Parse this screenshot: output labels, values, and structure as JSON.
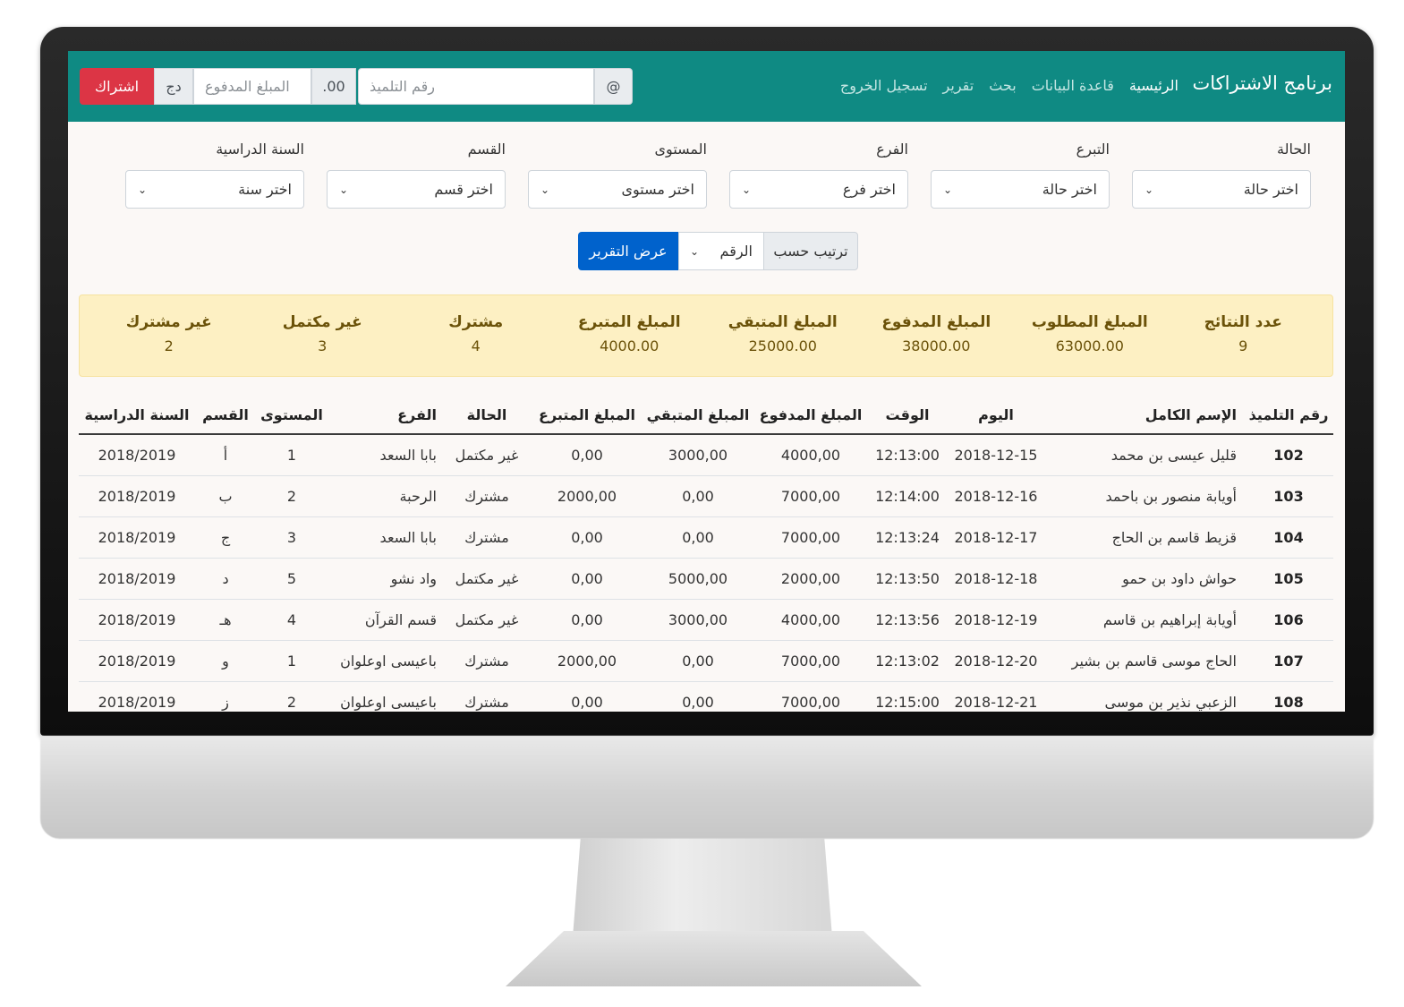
{
  "navbar": {
    "brand": "برنامج الاشتراكات",
    "links": [
      "الرئيسية",
      "قاعدة البيانات",
      "بحث",
      "تقرير",
      "تسجيل الخروج"
    ],
    "student_placeholder": "رقم التلميذ",
    "at_symbol": "@",
    "cents_addon": ".00",
    "amount_placeholder": "المبلغ المدفوع",
    "currency_addon": "دج",
    "subscribe_label": "اشتراك"
  },
  "filters": [
    {
      "label": "الحالة",
      "value": "اختر حالة"
    },
    {
      "label": "التبرع",
      "value": "اختر حالة"
    },
    {
      "label": "الفرع",
      "value": "اختر فرع"
    },
    {
      "label": "المستوى",
      "value": "اختر مستوى"
    },
    {
      "label": "القسم",
      "value": "اختر قسم"
    },
    {
      "label": "السنة الدراسية",
      "value": "اختر سنة"
    }
  ],
  "report": {
    "sort_label": "ترتيب حسب",
    "sort_value": "الرقم",
    "button_label": "عرض التقرير"
  },
  "summary": [
    {
      "title": "عدد النتائج",
      "value": "9"
    },
    {
      "title": "المبلغ المطلوب",
      "value": "63000.00"
    },
    {
      "title": "المبلغ المدفوع",
      "value": "38000.00"
    },
    {
      "title": "المبلغ المتبقي",
      "value": "25000.00"
    },
    {
      "title": "المبلغ المتبرع",
      "value": "4000.00"
    },
    {
      "title": "مشترك",
      "value": "4"
    },
    {
      "title": "غير مكتمل",
      "value": "3"
    },
    {
      "title": "غير مشترك",
      "value": "2"
    }
  ],
  "table": {
    "headers": [
      "رقم التلميذ",
      "الإسم الكامل",
      "اليوم",
      "الوقت",
      "المبلغ المدفوع",
      "المبلغ المتبقي",
      "المبلغ المتبرع",
      "الحالة",
      "الفرع",
      "المستوى",
      "القسم",
      "السنة الدراسية"
    ],
    "rows": [
      [
        "102",
        "قليل عيسى بن محمد",
        "2018-12-15",
        "12:13:00",
        "4000,00",
        "3000,00",
        "0,00",
        "غير مكتمل",
        "بابا السعد",
        "1",
        "أ",
        "2018/2019"
      ],
      [
        "103",
        "أويابة منصور بن باحمد",
        "2018-12-16",
        "12:14:00",
        "7000,00",
        "0,00",
        "2000,00",
        "مشترك",
        "الرحبة",
        "2",
        "ب",
        "2018/2019"
      ],
      [
        "104",
        "قزيط قاسم بن الحاج",
        "2018-12-17",
        "12:13:24",
        "7000,00",
        "0,00",
        "0,00",
        "مشترك",
        "بابا السعد",
        "3",
        "ج",
        "2018/2019"
      ],
      [
        "105",
        "حواش داود بن حمو",
        "2018-12-18",
        "12:13:50",
        "2000,00",
        "5000,00",
        "0,00",
        "غير مكتمل",
        "واد نشو",
        "5",
        "د",
        "2018/2019"
      ],
      [
        "106",
        "أويابة إبراهيم بن قاسم",
        "2018-12-19",
        "12:13:56",
        "4000,00",
        "3000,00",
        "0,00",
        "غير مكتمل",
        "قسم القرآن",
        "4",
        "هـ",
        "2018/2019"
      ],
      [
        "107",
        "الحاج موسى قاسم بن بشير",
        "2018-12-20",
        "12:13:02",
        "7000,00",
        "0,00",
        "2000,00",
        "مشترك",
        "باعيسى اوعلوان",
        "1",
        "و",
        "2018/2019"
      ],
      [
        "108",
        "الزعبي نذير بن موسى",
        "2018-12-21",
        "12:15:00",
        "7000,00",
        "0,00",
        "0,00",
        "مشترك",
        "باعيسى اوعلوان",
        "2",
        "ز",
        "2018/2019"
      ]
    ]
  },
  "colors": {
    "navbar": "#0f8a83",
    "subscribe_button": "#dc3545",
    "report_button": "#0062cc",
    "summary_bg": "#fdf0c3",
    "summary_text": "#6b5209"
  },
  "icons": {
    "select_arrow": "chevron-down-icon"
  }
}
